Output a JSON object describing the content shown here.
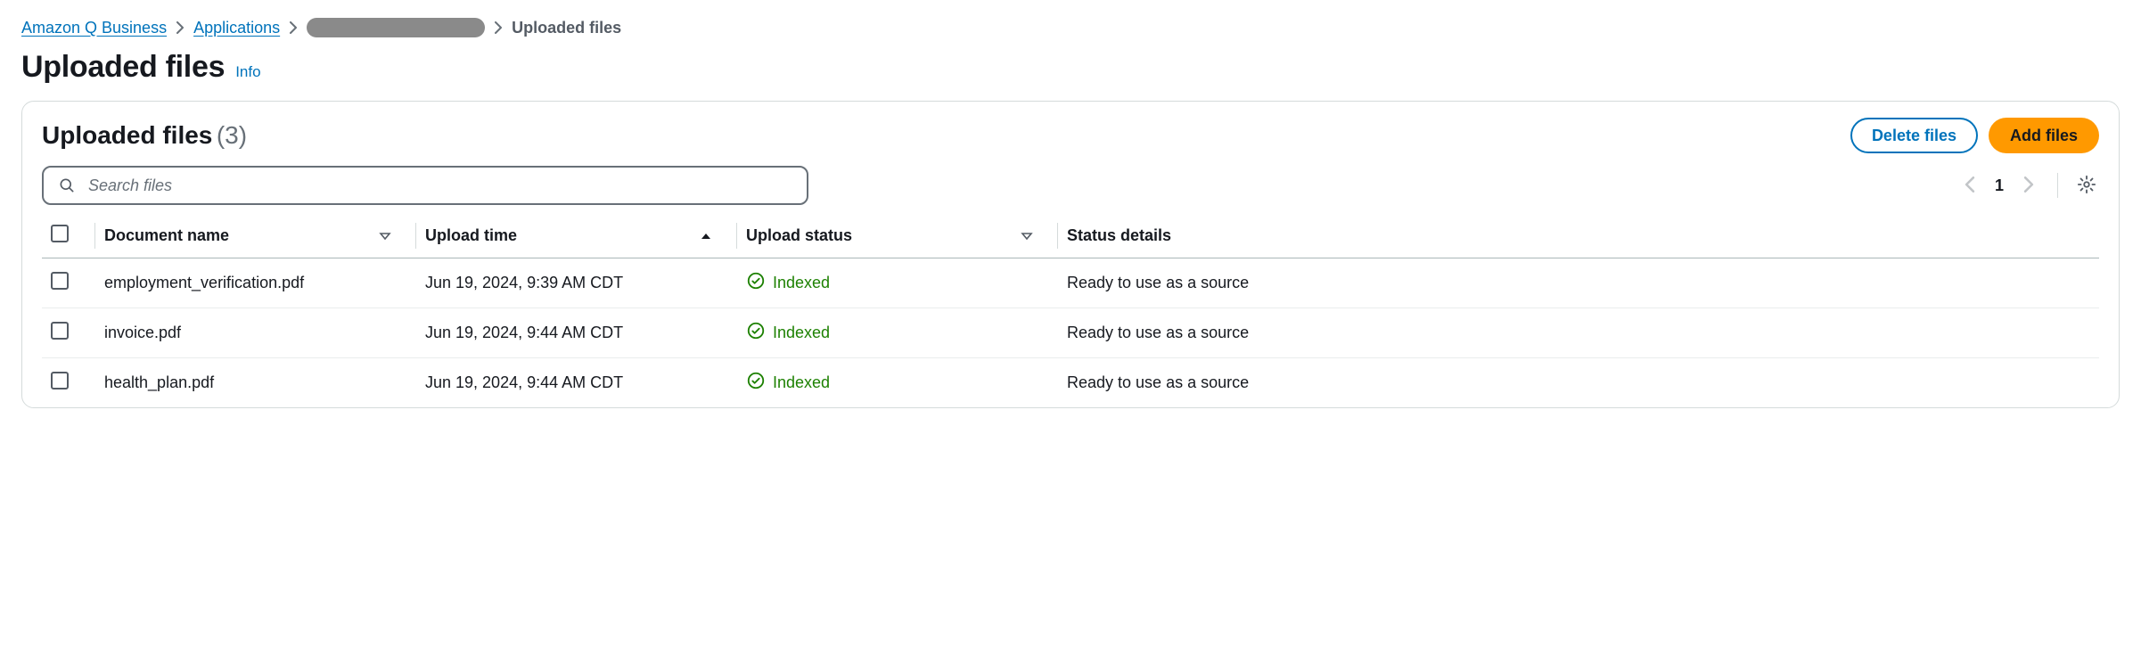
{
  "breadcrumb": {
    "items": [
      {
        "label": "Amazon Q Business"
      },
      {
        "label": "Applications"
      }
    ],
    "current": "Uploaded files"
  },
  "page": {
    "title": "Uploaded files",
    "info_label": "Info"
  },
  "panel": {
    "title": "Uploaded files",
    "count": "(3)",
    "delete_label": "Delete files",
    "add_label": "Add files"
  },
  "search": {
    "placeholder": "Search files"
  },
  "pagination": {
    "page": "1"
  },
  "table": {
    "headers": {
      "name": "Document name",
      "time": "Upload time",
      "status": "Upload status",
      "details": "Status details"
    },
    "rows": [
      {
        "name": "employment_verification.pdf",
        "time": "Jun 19, 2024, 9:39 AM CDT",
        "status": "Indexed",
        "details": "Ready to use as a source"
      },
      {
        "name": "invoice.pdf",
        "time": "Jun 19, 2024, 9:44 AM CDT",
        "status": "Indexed",
        "details": "Ready to use as a source"
      },
      {
        "name": "health_plan.pdf",
        "time": "Jun 19, 2024, 9:44 AM CDT",
        "status": "Indexed",
        "details": "Ready to use as a source"
      }
    ]
  }
}
